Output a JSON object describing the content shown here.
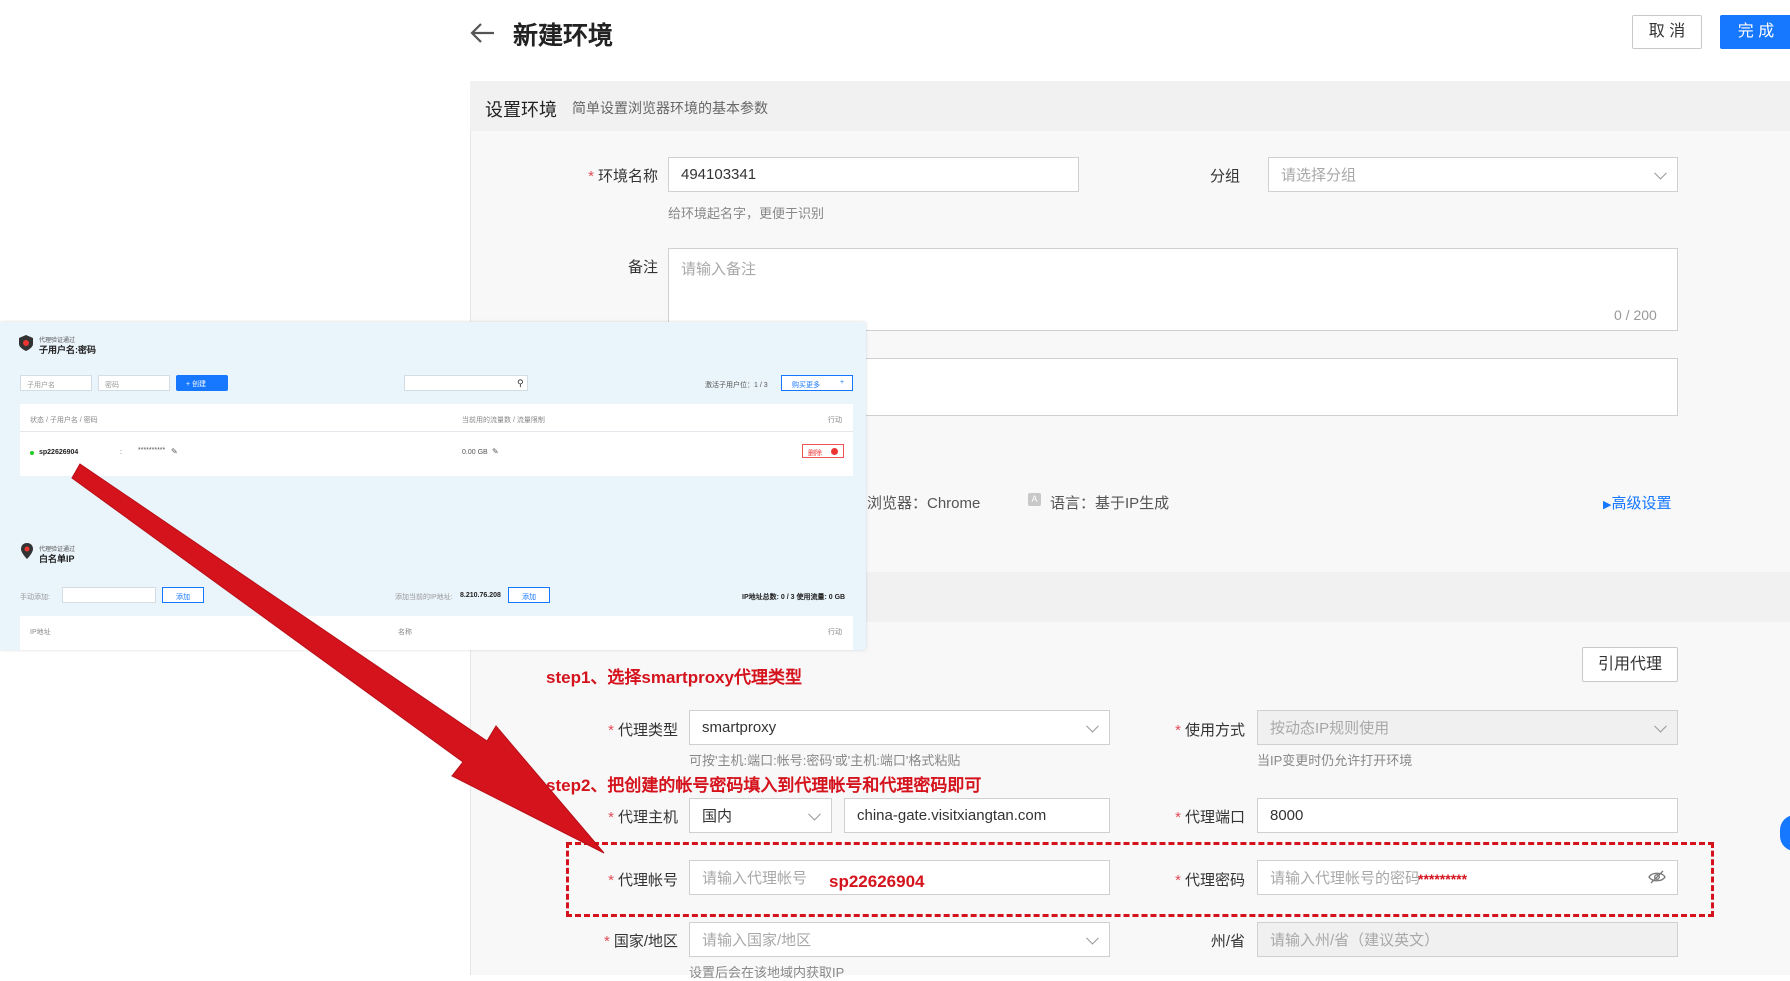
{
  "header": {
    "title": "新建环境",
    "cancel_label": "取 消",
    "done_label": "完 成"
  },
  "section": {
    "title": "设置环境",
    "subtitle": "简单设置浏览器环境的基本参数"
  },
  "form": {
    "env_name": {
      "label": "环境名称",
      "value": "494103341",
      "hint": "给环境起名字，更便于识别"
    },
    "group": {
      "label": "分组",
      "placeholder": "请选择分组"
    },
    "remark": {
      "label": "备注",
      "placeholder": "请输入备注",
      "counter": "0 / 200"
    },
    "browser_info": "浏览器：Chrome",
    "language_info": "语言：基于IP生成",
    "advanced": "高级设置"
  },
  "overlay": {
    "sub_title_small": "代理验证通过",
    "sub_title": "子用户名:密码",
    "username_ph": "子用户名",
    "password_ph": "密码",
    "create_btn": "+ 创建",
    "activated": "激活子用户位：1 / 3",
    "buy_more": "购买更多",
    "buy_plus": "+",
    "col_status": "状态 / 子用户名 / 密码",
    "col_traffic": "当前用的流量数 / 流量限制",
    "col_action": "行动",
    "row_user": "sp22626904",
    "row_colon": ":",
    "row_pwd": "**********",
    "row_traffic": "0.00 GB",
    "row_delete": "删除",
    "wl_title_small": "代理验证通过",
    "wl_title": "白名单IP",
    "manual_add": "手动添加:",
    "add_btn": "添加",
    "add_current": "添加当前的IP地址:",
    "current_ip": "8.210.76.208",
    "add_btn2": "添加",
    "ip_total": "IP地址总数: 0 / 3   使用流量: 0 GB",
    "col_ip": "IP地址",
    "col_name": "名称",
    "col_action2": "行动"
  },
  "proxy": {
    "cite_btn": "引用代理",
    "step1": "step1、选择smartproxy代理类型",
    "step2": "step2、把创建的帐号密码填入到代理帐号和代理密码即可",
    "type": {
      "label": "代理类型",
      "value": "smartproxy",
      "hint": "可按'主机:端口:帐号:密码'或'主机:端口'格式粘贴"
    },
    "usage": {
      "label": "使用方式",
      "value": "按动态IP规则使用",
      "hint": "当IP变更时仍允许打开环境"
    },
    "host": {
      "label": "代理主机",
      "region": "国内",
      "value": "china-gate.visitxiangtan.com"
    },
    "port": {
      "label": "代理端口",
      "value": "8000"
    },
    "account": {
      "label": "代理帐号",
      "placeholder": "请输入代理帐号",
      "fill": "sp22626904"
    },
    "password": {
      "label": "代理密码",
      "placeholder": "请输入代理帐号的密码",
      "fill": "*********"
    },
    "country": {
      "label": "国家/地区",
      "placeholder": "请输入国家/地区",
      "hint": "设置后会在该地域内获取IP"
    },
    "state": {
      "label": "州/省",
      "placeholder": "请输入州/省（建议英文）"
    }
  },
  "colors": {
    "primary": "#1677ff",
    "annotation_red": "#d4131d",
    "required": "#e34d59"
  }
}
